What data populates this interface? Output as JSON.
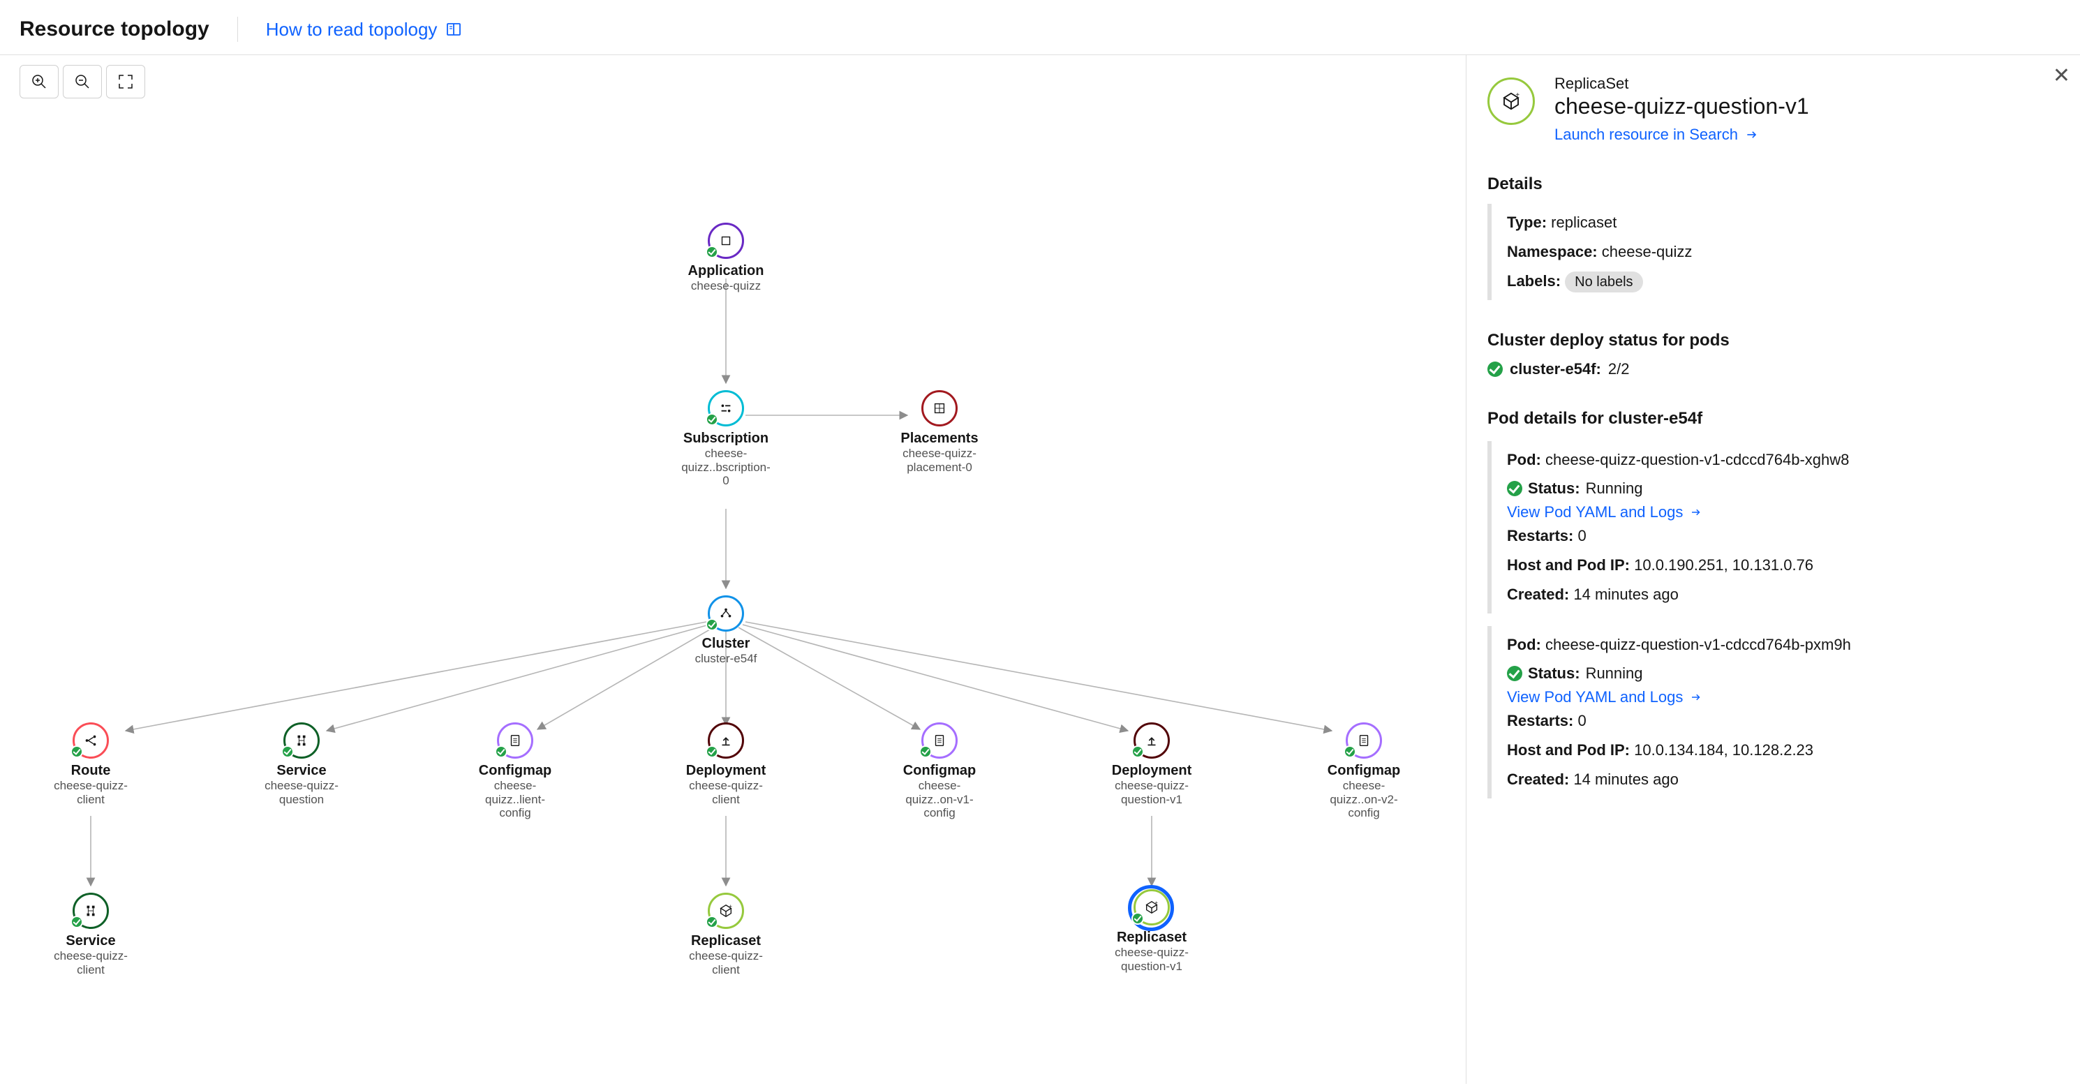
{
  "header": {
    "title": "Resource topology",
    "help": "How to read topology"
  },
  "toolbar": {
    "zoom_in": "Zoom in",
    "zoom_out": "Zoom out",
    "fit": "Fit to screen"
  },
  "nodes": {
    "application": {
      "title": "Application",
      "sub": "cheese-quizz",
      "color": "#6929c4"
    },
    "subscription": {
      "title": "Subscription",
      "sub": "cheese-quizz..bscription-0",
      "color": "#00bcd4"
    },
    "placements": {
      "title": "Placements",
      "sub": "cheese-quizz-placement-0",
      "color": "#a2191f"
    },
    "cluster": {
      "title": "Cluster",
      "sub": "cluster-e54f",
      "color": "#1192e8"
    },
    "route": {
      "title": "Route",
      "sub": "cheese-quizz-client",
      "color": "#fa4d56"
    },
    "service1": {
      "title": "Service",
      "sub": "cheese-quizz-question",
      "color": "#0e6027"
    },
    "cm1": {
      "title": "Configmap",
      "sub": "cheese-quizz..lient-config",
      "color": "#a56eff"
    },
    "dep1": {
      "title": "Deployment",
      "sub": "cheese-quizz-client",
      "color": "#520408"
    },
    "cm2": {
      "title": "Configmap",
      "sub": "cheese-quizz..on-v1-config",
      "color": "#a56eff"
    },
    "dep2": {
      "title": "Deployment",
      "sub": "cheese-quizz-question-v1",
      "color": "#520408"
    },
    "cm3": {
      "title": "Configmap",
      "sub": "cheese-quizz..on-v2-config",
      "color": "#a56eff"
    },
    "service2": {
      "title": "Service",
      "sub": "cheese-quizz-client",
      "color": "#0e6027"
    },
    "rs1": {
      "title": "Replicaset",
      "sub": "cheese-quizz-client",
      "color": "#96c93d"
    },
    "rs2": {
      "title": "Replicaset",
      "sub": "cheese-quizz-question-v1",
      "color": "#96c93d"
    }
  },
  "panel": {
    "kind": "ReplicaSet",
    "name": "cheese-quizz-question-v1",
    "launch": "Launch resource in Search",
    "details_h": "Details",
    "type_l": "Type:",
    "type_v": "replicaset",
    "ns_l": "Namespace:",
    "ns_v": "cheese-quizz",
    "labels_l": "Labels:",
    "labels_v": "No labels",
    "cluster_h": "Cluster deploy status for pods",
    "cluster_name": "cluster-e54f:",
    "cluster_val": "2/2",
    "pod_h": "Pod details for cluster-e54f",
    "pods": [
      {
        "pod_l": "Pod:",
        "pod_v": "cheese-quizz-question-v1-cdccd764b-xghw8",
        "status_l": "Status:",
        "status_v": "Running",
        "link": "View Pod YAML and Logs",
        "restarts_l": "Restarts:",
        "restarts_v": "0",
        "ip_l": "Host and Pod IP:",
        "ip_v": "10.0.190.251, 10.131.0.76",
        "created_l": "Created:",
        "created_v": "14 minutes ago"
      },
      {
        "pod_l": "Pod:",
        "pod_v": "cheese-quizz-question-v1-cdccd764b-pxm9h",
        "status_l": "Status:",
        "status_v": "Running",
        "link": "View Pod YAML and Logs",
        "restarts_l": "Restarts:",
        "restarts_v": "0",
        "ip_l": "Host and Pod IP:",
        "ip_v": "10.0.134.184, 10.128.2.23",
        "created_l": "Created:",
        "created_v": "14 minutes ago"
      }
    ]
  }
}
